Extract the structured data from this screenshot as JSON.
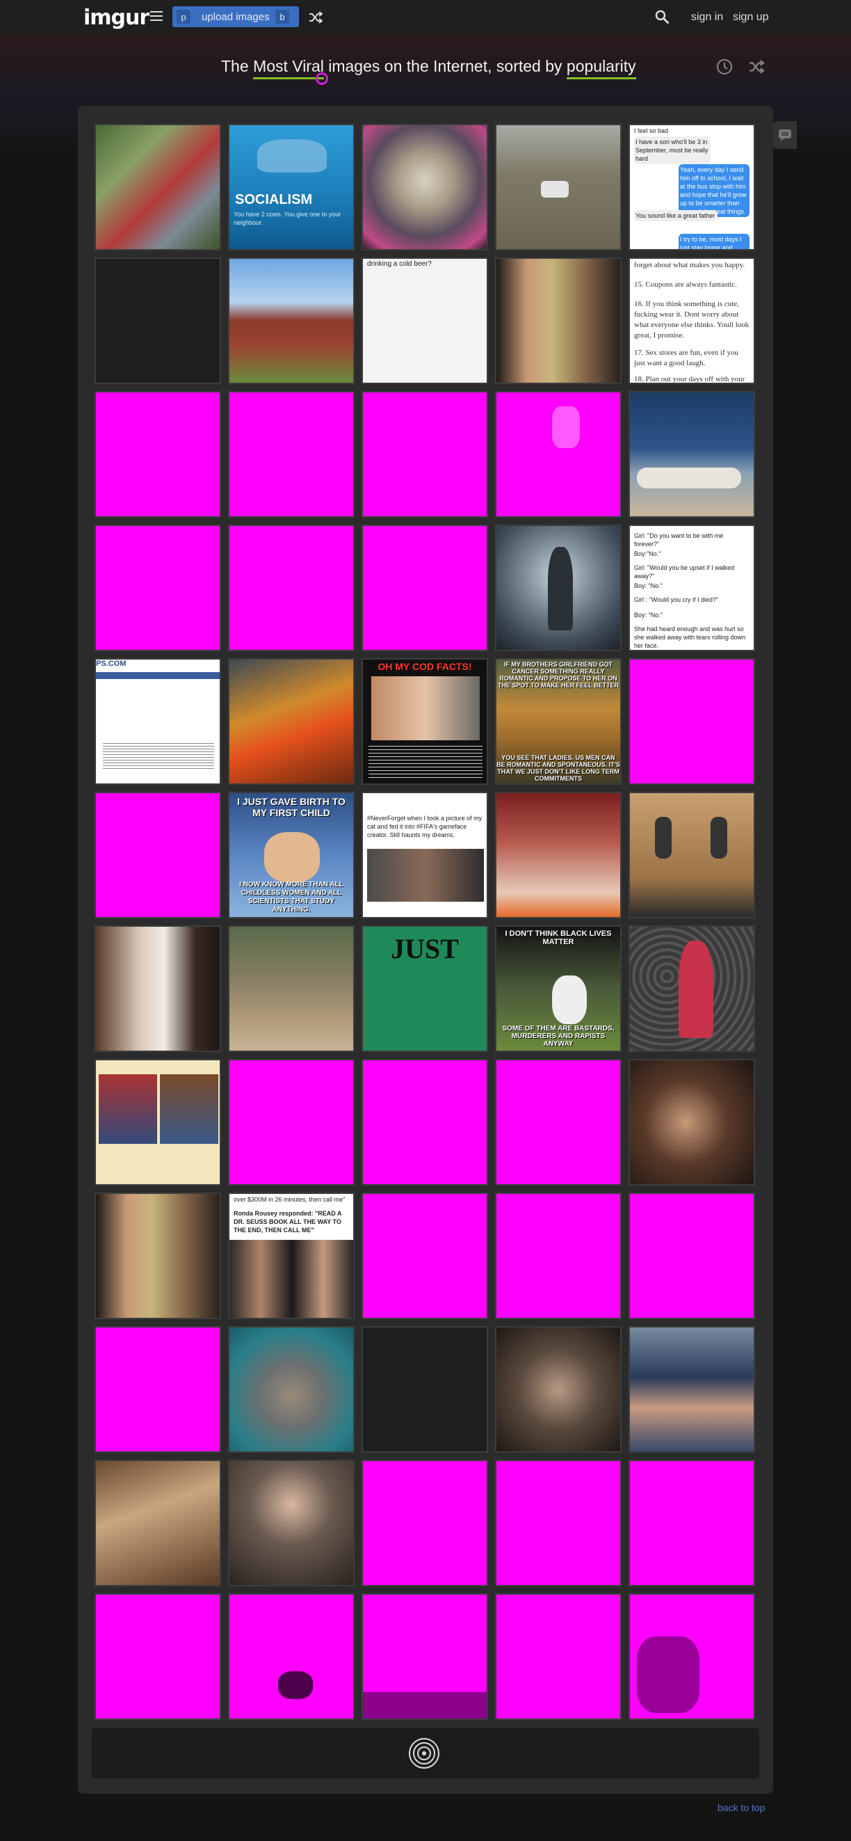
{
  "header": {
    "logo": "imgur",
    "upload_label": "upload images",
    "upload_key": "p",
    "upload_key2": "b",
    "signin": "sign in",
    "signup": "sign up"
  },
  "headline": {
    "prefix": "The",
    "section": "Most Viral",
    "middle": "images on the Internet, sorted by",
    "sort": "popularity"
  },
  "colors": {
    "accent_green": "#85bf25",
    "link_blue": "#4e76c9",
    "button_blue": "#3a6fc2",
    "missing_image_magenta": "#ff00ff"
  },
  "thumbs": {
    "socialism_title": "SOCIALISM",
    "socialism_text": "You have 2 cows. You give one to your neighbour.",
    "chat_1": "I feel so bad",
    "chat_2": "I have a son who'll be 3 in September, must be really hard",
    "chat_3": "Yeah, every day I send him off to school, I wait at the bus stop with him and hope that he'll grow up to be smarter than me and do great things.",
    "chat_4": "You sound like a great father",
    "chat_5": "I try to be, most days I just stay home and watch over",
    "beer_text": "drinking a cold beer?",
    "list_1": "forget about what makes you happy.",
    "list_2": "15. Coupons are always fantastic.",
    "list_3": "16. If you think something is cute, fucking wear it. Dont worry about what everyone else thinks. Youll look great, I promise.",
    "list_4": "17. Sex stores are fun, even if you just want a good laugh.",
    "list_5": "18. Plan out your days off with your",
    "girl_1": "Girl: \"Do you want to be with me forever?\"",
    "girl_2": "Boy:\"No.\"",
    "girl_3": "Girl: \"Would you be upset if I walked away?\"",
    "girl_4": "Boy: \"No.\"",
    "girl_5": "Girl : \"Would you cry if I died?\"",
    "girl_6": "Boy: \"No.\"",
    "girl_7": "She had heard enough and was hurt so she walked away with tears rolling down her face.",
    "ps_text": "PS.COM",
    "cod_title": "OH MY COD FACTS!",
    "tiger_top": "IF MY BROTHERS GIRLFRIEND GOT CANCER SOMETHING REALLY ROMANTIC AND PROPOSE TO HER ON THE SPOT TO MAKE HER FEEL BETTER",
    "tiger_bottom": "YOU SEE THAT LADIES. US MEN CAN BE ROMANTIC AND SPONTANEOUS. IT'S THAT WE JUST DON'T LIKE LONG TERM COMMITMENTS",
    "baby_top": "I JUST GAVE BIRTH TO MY FIRST CHILD",
    "baby_bottom": "I NOW KNOW MORE THAN ALL CHILDLESS WOMEN AND ALL SCIENTISTS THAT STUDY ANYTHING.",
    "never_forget": "#NeverForget when I took a picture of my cat and fed it into #FIFA's gameface creator. Still haunts my dreams.",
    "puffin_top": "I DON'T THINK BLACK LIVES MATTER",
    "puffin_bottom": "SOME OF THEM ARE BASTARDS, MURDERERS AND RAPISTS ANYWAY",
    "just_text": "JUST",
    "ronda_1": "over $300M in 26 minutes, then call me\"",
    "ronda_2": "Ronda Rousey responded: \"READ A DR. SEUSS BOOK ALL THE WAY TO THE END, THEN CALL ME\""
  },
  "footer": {
    "back_to_top": "back to top"
  }
}
